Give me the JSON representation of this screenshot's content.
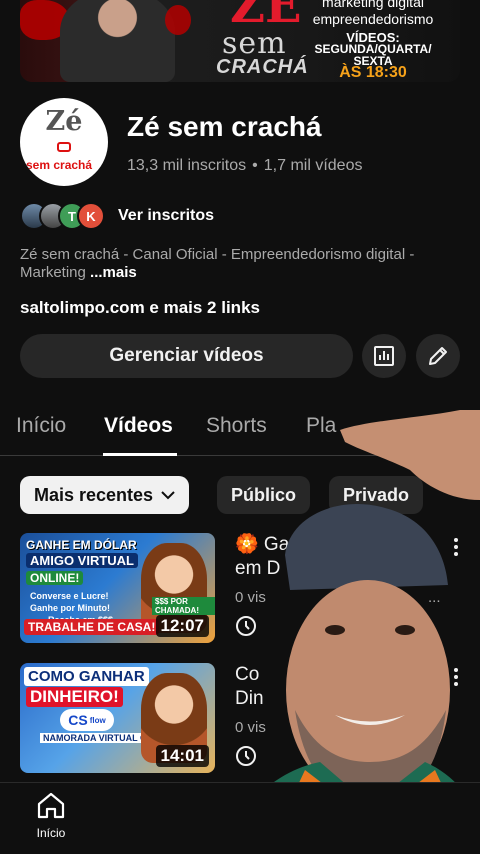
{
  "banner": {
    "line1": "marketing digital",
    "line2": "empreendedorismo",
    "line3": "VÍDEOS:",
    "line4": "SEGUNDA/QUARTA/",
    "line5": "SEXTA",
    "line6": "ÀS 18:30",
    "logo_ze": "ZÉ",
    "logo_sem": "sem",
    "logo_cracha": "CRACHÁ"
  },
  "channel": {
    "avatar_ze": "Zé",
    "avatar_sem": "sem crachá",
    "name": "Zé sem crachá",
    "subscribers": "13,3 mil inscritos",
    "separator": "•",
    "videos": "1,7 mil vídeos",
    "subscriber_initials": [
      "",
      "",
      "T",
      "K"
    ],
    "see_subscribers": "Ver inscritos",
    "description": "Zé sem crachá - Canal Oficial - Empreendedorismo digital - Marketing",
    "more": "...mais",
    "links": "saltolimpo.com e mais 2 links",
    "manage_videos": "Gerenciar vídeos"
  },
  "tabs": [
    "Início",
    "Vídeos",
    "Shorts",
    "Pla"
  ],
  "active_tab": "Vídeos",
  "filters": {
    "sort_label": "Mais recentes",
    "public": "Público",
    "private": "Privado"
  },
  "videos": [
    {
      "title_line1": "🏵️ Ga",
      "title_line2": "em D",
      "meta": "0 vis",
      "meta_tail": "...",
      "duration": "12:07",
      "thumb": {
        "head1": "GANHE EM DÓLAR",
        "head2": "AMIGO VIRTUAL",
        "head3": "ONLINE!",
        "bullet1": "Converse e Lucre!",
        "bullet2": "Ganhe por Minuto!",
        "bullet3": "Receba em $$$",
        "tag": "$$$ POR CHAMADA!",
        "bottom": "TRABALHE DE CASA!"
      }
    },
    {
      "title_line1": "Co",
      "title_line2": "Din",
      "meta": "0 vis",
      "meta_tail": "...",
      "duration": "14:01",
      "thumb": {
        "head1": "COMO GANHAR",
        "head2": "DINHEIRO!",
        "logo": "CS",
        "logo_sub": "flow",
        "sub": "NAMORADA VIRTUAL COM IA"
      }
    }
  ],
  "nav": {
    "home": "Início"
  },
  "colors": {
    "background": "#0f0f0f",
    "chip": "#272727",
    "accent_red": "#e31b2c",
    "banner_orange": "#f6a21a"
  }
}
